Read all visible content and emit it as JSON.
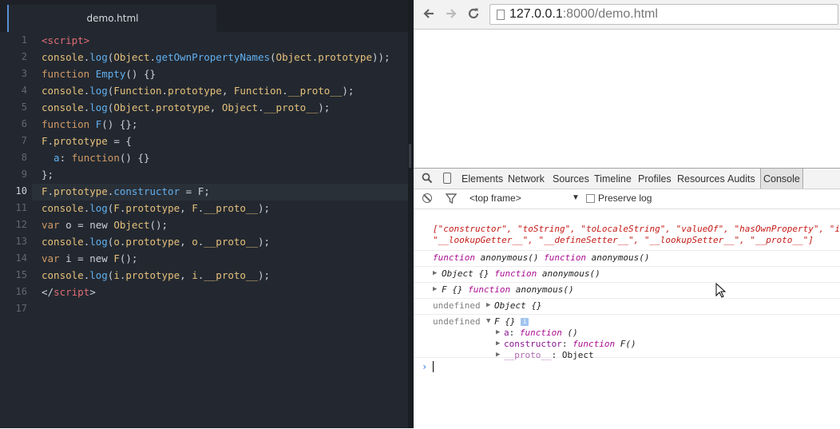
{
  "editor": {
    "tab_title": "demo.html",
    "line_numbers": [
      "1",
      "2",
      "3",
      "4",
      "5",
      "6",
      "7",
      "8",
      "9",
      "10",
      "11",
      "12",
      "13",
      "14",
      "15",
      "16",
      "17"
    ],
    "active_line": "10",
    "lines": [
      [
        {
          "t": "<script>",
          "c": "tag"
        }
      ],
      [
        {
          "t": "console",
          "c": "obj"
        },
        {
          "t": ".",
          "c": "punc"
        },
        {
          "t": "log",
          "c": "prop"
        },
        {
          "t": "(",
          "c": "punc"
        },
        {
          "t": "Object",
          "c": "obj"
        },
        {
          "t": ".",
          "c": "punc"
        },
        {
          "t": "getOwnPropertyNames",
          "c": "prop"
        },
        {
          "t": "(",
          "c": "punc"
        },
        {
          "t": "Object",
          "c": "obj"
        },
        {
          "t": ".",
          "c": "punc"
        },
        {
          "t": "prototype",
          "c": "obj"
        },
        {
          "t": "));",
          "c": "punc"
        }
      ],
      [
        {
          "t": "function ",
          "c": "kw"
        },
        {
          "t": "Empty",
          "c": "prop"
        },
        {
          "t": "() {}",
          "c": "punc"
        }
      ],
      [
        {
          "t": "console",
          "c": "obj"
        },
        {
          "t": ".",
          "c": "punc"
        },
        {
          "t": "log",
          "c": "prop"
        },
        {
          "t": "(",
          "c": "punc"
        },
        {
          "t": "Function",
          "c": "obj"
        },
        {
          "t": ".",
          "c": "punc"
        },
        {
          "t": "prototype",
          "c": "obj"
        },
        {
          "t": ", ",
          "c": "punc"
        },
        {
          "t": "Function",
          "c": "obj"
        },
        {
          "t": ".",
          "c": "punc"
        },
        {
          "t": "__proto__",
          "c": "obj"
        },
        {
          "t": ");",
          "c": "punc"
        }
      ],
      [
        {
          "t": "console",
          "c": "obj"
        },
        {
          "t": ".",
          "c": "punc"
        },
        {
          "t": "log",
          "c": "prop"
        },
        {
          "t": "(",
          "c": "punc"
        },
        {
          "t": "Object",
          "c": "obj"
        },
        {
          "t": ".",
          "c": "punc"
        },
        {
          "t": "prototype",
          "c": "obj"
        },
        {
          "t": ", ",
          "c": "punc"
        },
        {
          "t": "Object",
          "c": "obj"
        },
        {
          "t": ".",
          "c": "punc"
        },
        {
          "t": "__proto__",
          "c": "obj"
        },
        {
          "t": ");",
          "c": "punc"
        }
      ],
      [
        {
          "t": "function ",
          "c": "kw"
        },
        {
          "t": "F",
          "c": "prop"
        },
        {
          "t": "() {};",
          "c": "punc"
        }
      ],
      [
        {
          "t": "F",
          "c": "obj"
        },
        {
          "t": ".",
          "c": "punc"
        },
        {
          "t": "prototype",
          "c": "obj"
        },
        {
          "t": " = {",
          "c": "punc"
        }
      ],
      [
        {
          "t": "  a",
          "c": "prop"
        },
        {
          "t": ": ",
          "c": "punc"
        },
        {
          "t": "function",
          "c": "kw"
        },
        {
          "t": "() {}",
          "c": "punc"
        }
      ],
      [
        {
          "t": "};",
          "c": "punc"
        }
      ],
      [
        {
          "t": "F",
          "c": "obj"
        },
        {
          "t": ".",
          "c": "punc"
        },
        {
          "t": "prototype",
          "c": "obj"
        },
        {
          "t": ".",
          "c": "punc"
        },
        {
          "t": "constructor",
          "c": "prop"
        },
        {
          "t": " = F;",
          "c": "punc"
        }
      ],
      [
        {
          "t": "console",
          "c": "obj"
        },
        {
          "t": ".",
          "c": "punc"
        },
        {
          "t": "log",
          "c": "prop"
        },
        {
          "t": "(",
          "c": "punc"
        },
        {
          "t": "F",
          "c": "obj"
        },
        {
          "t": ".",
          "c": "punc"
        },
        {
          "t": "prototype",
          "c": "obj"
        },
        {
          "t": ", ",
          "c": "punc"
        },
        {
          "t": "F",
          "c": "obj"
        },
        {
          "t": ".",
          "c": "punc"
        },
        {
          "t": "__proto__",
          "c": "obj"
        },
        {
          "t": ");",
          "c": "punc"
        }
      ],
      [
        {
          "t": "var ",
          "c": "kw"
        },
        {
          "t": "o = ",
          "c": "punc"
        },
        {
          "t": "new ",
          "c": "punc"
        },
        {
          "t": "Object",
          "c": "obj"
        },
        {
          "t": "();",
          "c": "punc"
        }
      ],
      [
        {
          "t": "console",
          "c": "obj"
        },
        {
          "t": ".",
          "c": "punc"
        },
        {
          "t": "log",
          "c": "prop"
        },
        {
          "t": "(",
          "c": "punc"
        },
        {
          "t": "o",
          "c": "obj"
        },
        {
          "t": ".",
          "c": "punc"
        },
        {
          "t": "prototype",
          "c": "obj"
        },
        {
          "t": ", ",
          "c": "punc"
        },
        {
          "t": "o",
          "c": "obj"
        },
        {
          "t": ".",
          "c": "punc"
        },
        {
          "t": "__proto__",
          "c": "obj"
        },
        {
          "t": ");",
          "c": "punc"
        }
      ],
      [
        {
          "t": "var ",
          "c": "kw"
        },
        {
          "t": "i = ",
          "c": "punc"
        },
        {
          "t": "new ",
          "c": "punc"
        },
        {
          "t": "F",
          "c": "obj"
        },
        {
          "t": "();",
          "c": "punc"
        }
      ],
      [
        {
          "t": "console",
          "c": "obj"
        },
        {
          "t": ".",
          "c": "punc"
        },
        {
          "t": "log",
          "c": "prop"
        },
        {
          "t": "(",
          "c": "punc"
        },
        {
          "t": "i",
          "c": "obj"
        },
        {
          "t": ".",
          "c": "punc"
        },
        {
          "t": "prototype",
          "c": "obj"
        },
        {
          "t": ", ",
          "c": "punc"
        },
        {
          "t": "i",
          "c": "obj"
        },
        {
          "t": ".",
          "c": "punc"
        },
        {
          "t": "__proto__",
          "c": "obj"
        },
        {
          "t": ");",
          "c": "punc"
        }
      ],
      [
        {
          "t": "</",
          "c": "punc"
        },
        {
          "t": "script",
          "c": "tag"
        },
        {
          "t": ">",
          "c": "punc"
        }
      ],
      []
    ]
  },
  "browser": {
    "url_host": "127.0.0.1",
    "url_rest": ":8000/demo.html"
  },
  "devtools": {
    "tabs": [
      "Elements",
      "Network",
      "Sources",
      "Timeline",
      "Profiles",
      "Resources",
      "Audits",
      "Console"
    ],
    "active_tab": "Console",
    "frame": "<top frame>",
    "preserve_log": "Preserve log"
  },
  "console": {
    "msg1_line1": "[\"constructor\", \"toString\", \"toLocaleString\", \"valueOf\", \"hasOwnProperty\", \"i",
    "msg1_line2": "\"__lookupGetter__\", \"__defineSetter__\", \"__lookupSetter__\", \"__proto__\"]",
    "msg2_a": "function",
    "msg2_b": " anonymous() ",
    "msg2_c": "function",
    "msg2_d": " anonymous()",
    "msg3_a": "Object {} ",
    "msg3_b": "function",
    "msg3_c": " anonymous()",
    "msg4_a": "F {} ",
    "msg4_b": "function",
    "msg4_c": " anonymous()",
    "undefined": "undefined",
    "msg5_obj": "Object {}",
    "msg6_obj": "F {}",
    "info": "i",
    "prop_a_key": "a",
    "prop_a_val_fn": "function",
    "prop_a_val": " ()",
    "prop_ctor_key": "constructor",
    "prop_ctor_fn": "function",
    "prop_ctor_val": " F()",
    "prop_proto_key": "__proto__",
    "prop_proto_val": ": Object",
    "prompt": "›"
  }
}
